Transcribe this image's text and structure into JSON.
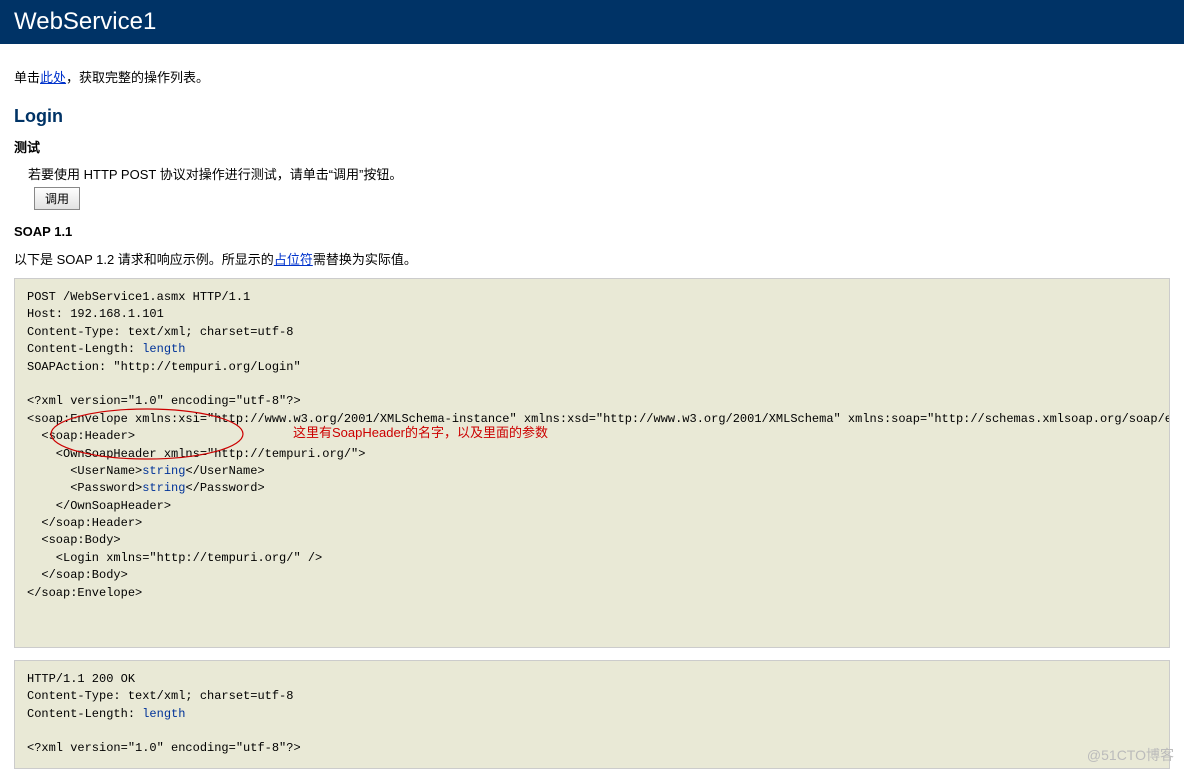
{
  "header": {
    "title": "WebService1"
  },
  "intro": {
    "prefix": "单击",
    "link": "此处",
    "suffix": "，获取完整的操作列表。"
  },
  "operation": {
    "name": "Login"
  },
  "test": {
    "heading": "测试",
    "desc": "若要使用 HTTP POST 协议对操作进行测试，请单击“调用”按钮。",
    "button": "调用"
  },
  "soap": {
    "label": "SOAP 1.1",
    "descPrefix": "以下是 SOAP 1.2 请求和响应示例。所显示的",
    "placeholderWord": "占位符",
    "descSuffix": "需替换为实际值。"
  },
  "request": {
    "l1": "POST /WebService1.asmx HTTP/1.1",
    "l2": "Host: 192.168.1.101",
    "l3": "Content-Type: text/xml; charset=utf-8",
    "l4": "Content-Length: ",
    "l4ph": "length",
    "l5": "SOAPAction: \"http://tempuri.org/Login\"",
    "l6": "<?xml version=\"1.0\" encoding=\"utf-8\"?>",
    "l7": "<soap:Envelope xmlns:xsi=\"http://www.w3.org/2001/XMLSchema-instance\" xmlns:xsd=\"http://www.w3.org/2001/XMLSchema\" xmlns:soap=\"http://schemas.xmlsoap.org/soap/envelope/\">",
    "l8": "  <soap:Header>",
    "l9": "    <OwnSoapHeader xmlns=\"http://tempuri.org/\">",
    "l10a": "      <UserName>",
    "l10ph": "string",
    "l10b": "</UserName>",
    "l11a": "      <Password>",
    "l11ph": "string",
    "l11b": "</Password>",
    "l12": "    </OwnSoapHeader>",
    "l13": "  </soap:Header>",
    "l14": "  <soap:Body>",
    "l15": "    <Login xmlns=\"http://tempuri.org/\" />",
    "l16": "  </soap:Body>",
    "l17": "</soap:Envelope>"
  },
  "annotation": {
    "text": "这里有SoapHeader的名字，以及里面的参数"
  },
  "response": {
    "l1": "HTTP/1.1 200 OK",
    "l2": "Content-Type: text/xml; charset=utf-8",
    "l3": "Content-Length: ",
    "l3ph": "length",
    "l4": "<?xml version=\"1.0\" encoding=\"utf-8\"?>"
  },
  "watermark": "@51CTO博客"
}
